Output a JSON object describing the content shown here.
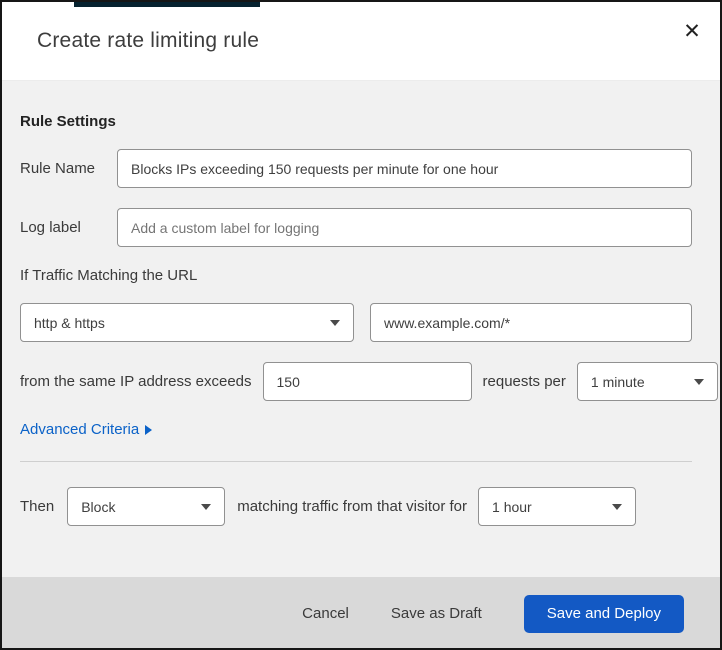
{
  "colors": {
    "accent_link_blue": "#0b62c8",
    "primary_button_blue": "#1359c4",
    "top_strip_navy": "#06222f",
    "body_gray": "#f1f1f1",
    "footer_gray": "#d9d9d9"
  },
  "modal": {
    "title": "Create rate limiting rule",
    "close_glyph": "✕"
  },
  "rule_settings": {
    "section_title": "Rule Settings",
    "rule_name": {
      "label": "Rule Name",
      "value": "Blocks IPs exceeding 150 requests per minute for one hour"
    },
    "log_label": {
      "label": "Log label",
      "placeholder": "Add a custom label for logging"
    },
    "traffic_match": {
      "intro": "If Traffic Matching the URL",
      "scheme_selected": "http & https",
      "url_value": "www.example.com/*",
      "threshold_text": "from the same IP address exceeds",
      "threshold_value": "150",
      "per_text": "requests per",
      "period_selected": "1 minute"
    },
    "advanced_criteria_label": "Advanced Criteria"
  },
  "action": {
    "then_label": "Then",
    "action_selected": "Block",
    "middle_text": "matching traffic from that visitor for",
    "duration_selected": "1 hour"
  },
  "footer": {
    "cancel_label": "Cancel",
    "save_draft_label": "Save as Draft",
    "save_deploy_label": "Save and Deploy"
  }
}
